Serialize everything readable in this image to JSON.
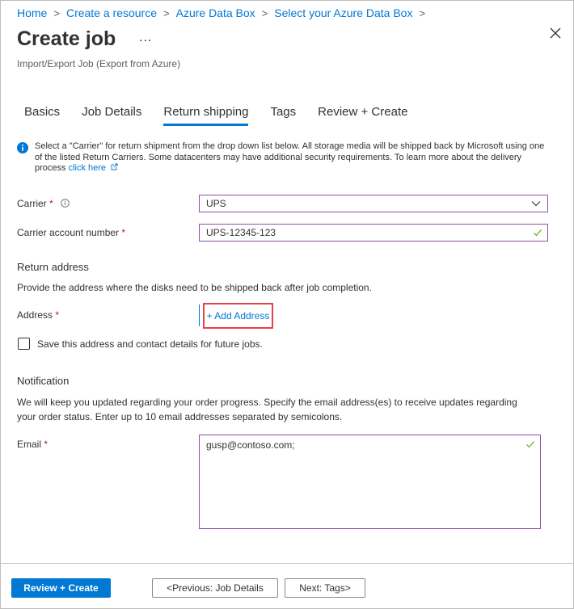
{
  "breadcrumb": {
    "items": [
      "Home",
      "Create a resource",
      "Azure Data Box",
      "Select your Azure Data Box"
    ],
    "separator": ">"
  },
  "header": {
    "title": "Create job",
    "more": "...",
    "subtitle": "Import/Export Job (Export from Azure)",
    "close_icon": "close-icon"
  },
  "tabs": [
    {
      "label": "Basics",
      "active": false
    },
    {
      "label": "Job Details",
      "active": false
    },
    {
      "label": "Return shipping",
      "active": true
    },
    {
      "label": "Tags",
      "active": false
    },
    {
      "label": "Review + Create",
      "active": false
    }
  ],
  "info": {
    "icon": "info-icon",
    "text": "Select a \"Carrier\" for return shipment from the drop down list below. All storage media will be shipped back by Microsoft using one of the listed Return Carriers. Some datacenters may have additional security requirements. To learn more about the delivery process ",
    "link_label": "click here",
    "link_icon": "external-link-icon"
  },
  "form": {
    "carrier": {
      "label": "Carrier",
      "required": "*",
      "value": "UPS"
    },
    "account": {
      "label": "Carrier account number",
      "required": "*",
      "value": "UPS-12345-123"
    },
    "return_address": {
      "heading": "Return address",
      "description": "Provide the address where the disks need to be shipped back after job completion.",
      "label": "Address",
      "required": "*",
      "add_label": "+ Add Address",
      "save_checkbox_label": "Save this address and contact details for future jobs.",
      "save_checked": false
    },
    "notification": {
      "heading": "Notification",
      "description": "We will keep you updated regarding your order progress. Specify the email address(es) to receive updates regarding your order status. Enter up to 10 email addresses separated by semicolons.",
      "email_label": "Email",
      "required": "*",
      "email_value": "gusp@contoso.com;"
    }
  },
  "footer": {
    "review_create": "Review + Create",
    "previous": "<Previous: Job Details",
    "next": "Next: Tags>"
  },
  "colors": {
    "accent": "#0078d4",
    "field_border": "#8a4fad",
    "highlight": "#e8414a",
    "required": "#a4262c",
    "valid": "#57a300"
  }
}
